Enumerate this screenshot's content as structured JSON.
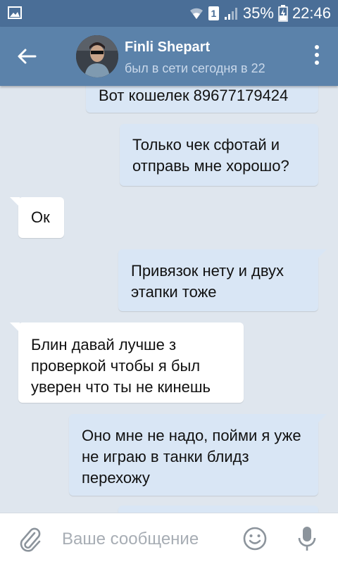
{
  "status_bar": {
    "sim_slot": "1",
    "battery": "35%",
    "time": "22:46"
  },
  "header": {
    "contact_name": "Finli Shepart",
    "contact_status": "был в сети сегодня в 22",
    "back_icon": "arrow-left-icon",
    "menu_icon": "more-vertical-icon"
  },
  "messages": [
    {
      "direction": "out",
      "text": "Вот кошелек 89677179424"
    },
    {
      "direction": "out",
      "text": "Только чек сфотай и отправь мне хорошо?"
    },
    {
      "direction": "in",
      "text": "Ок"
    },
    {
      "direction": "out",
      "text": "Привязок нету и двух этапки тоже"
    },
    {
      "direction": "in",
      "text": "Блин давай лучше з проверкой чтобы я был уверен что ты не кинешь"
    },
    {
      "direction": "out",
      "text": "Оно мне не надо, пойми я уже не играю в танки блидз перехожу"
    },
    {
      "direction": "out",
      "text": ""
    }
  ],
  "composer": {
    "placeholder": "Ваше сообщение",
    "attach_icon": "paperclip-icon",
    "emoji_icon": "emoji-icon",
    "mic_icon": "microphone-icon"
  },
  "colors": {
    "status_bar": "#4a6e97",
    "header": "#5b82aa",
    "background": "#dfe6ee",
    "outgoing_bubble": "#d9e6f5",
    "incoming_bubble": "#ffffff"
  }
}
